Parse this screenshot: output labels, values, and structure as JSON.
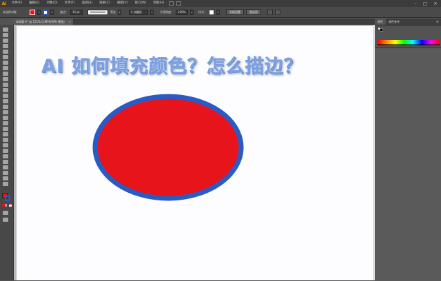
{
  "app": {
    "logo": "Ai"
  },
  "menu": [
    "文件(F)",
    "编辑(E)",
    "对象(O)",
    "文字(T)",
    "选择(S)",
    "效果(C)",
    "视图(V)",
    "窗口(W)",
    "帮助(H)"
  ],
  "window_controls": [
    "–",
    "□",
    "✕"
  ],
  "control_bar": {
    "object_label": "未选择对象",
    "fill_color": "#e8141c",
    "stroke_color": "#2a5bc5",
    "stroke_label": "描边：",
    "stroke_weight": "15 pt",
    "stroke_profile": "等比",
    "brush_label": "5 点圆形",
    "opacity_label": "不透明度：",
    "opacity_value": "100%",
    "style_label": "样式：",
    "doc_setup_button": "文档设置",
    "preferences_button": "首选项"
  },
  "document_tab": {
    "title": "未标题-2* @ 151% (CMYK/GPU 预览)",
    "close": "✕"
  },
  "canvas": {
    "headline": "AI 如何填充颜色？怎么描边？",
    "ellipse_fill": "#e8141c",
    "ellipse_stroke": "#2a5bc5"
  },
  "panels": {
    "tabs": [
      "颜色",
      "颜色参考"
    ],
    "menu_icon": "≡"
  }
}
